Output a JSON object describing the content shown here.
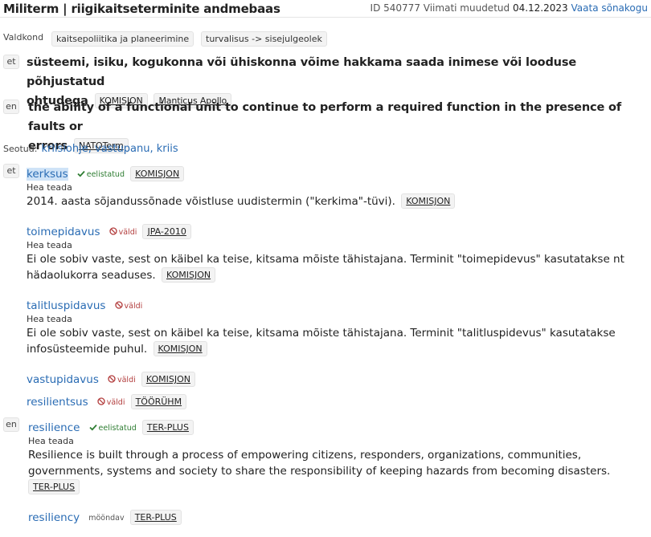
{
  "header": {
    "title": "Militerm | riigikaitseterminite andmebaas",
    "id_text": "ID 540777",
    "modified_text": "Viimati muudetud",
    "modified_date": "04.12.2023",
    "view_link": "Vaata sõnakogu"
  },
  "domain": {
    "label": "Valdkond",
    "tags": [
      "kaitsepoliitika ja planeerimine",
      "turvalisus -> sisejulgeolek"
    ]
  },
  "definitions": [
    {
      "lang": "et",
      "line1": "süsteemi, isiku, kogukonna või ühiskonna võime hakkama saada inimese või looduse põhjustatud",
      "line2": "ohtudega",
      "sources": [
        "KOMISJON",
        "Manticus Apollo"
      ]
    },
    {
      "lang": "en",
      "line1": "the ability of a functional unit to continue to perform a required function in the presence of faults or",
      "line2": "errors",
      "sources": [
        "NATOTerm"
      ]
    }
  ],
  "related": {
    "label": "Seotud:",
    "value": "kriisiohje, vastupanu, kriis"
  },
  "terms_et": [
    {
      "term": "kerksus",
      "status": "eelistatud",
      "source": "KOMISJON",
      "quality": "Hea teada",
      "note_line1": "2014. aasta sõjandussõnade võistluse uudistermin (\"kerkima\"-tüvi).",
      "note_source": "KOMISJON"
    },
    {
      "term": "toimepidavus",
      "status": "väldi",
      "source": "JPA-2010",
      "quality": "Hea teada",
      "note_line1": "Ei ole sobiv vaste, sest on käibel ka teise, kitsama mõiste tähistajana. Terminit \"toimepidevus\" kasutatakse nt",
      "note_line2": "hädaolukorra seaduses.",
      "note_source": "KOMISJON"
    },
    {
      "term": "talitluspidavus",
      "status": "väldi",
      "quality": "Hea teada",
      "note_line1": "Ei ole sobiv vaste, sest on käibel ka teise, kitsama mõiste tähistajana. Terminit \"talitluspidevus\" kasutatakse",
      "note_line2": "infosüsteemide puhul.",
      "note_source": "KOMISJON"
    },
    {
      "term": "vastupidavus",
      "status": "väldi",
      "source": "KOMISJON"
    },
    {
      "term": "resilientsus",
      "status": "väldi",
      "source": "TÖÖRÜHM"
    }
  ],
  "terms_en": [
    {
      "lang": "en",
      "term": "resilience",
      "status": "eelistatud",
      "source": "TER-PLUS",
      "quality": "Hea teada",
      "note_line1": "Resilience is built through a process of empowering citizens, responders, organizations, communities,",
      "note_line2": "governments, systems and society to share the responsibility of keeping hazards from becoming disasters.",
      "note_source": "TER-PLUS"
    },
    {
      "term": "resiliency",
      "status": "mööndav",
      "source": "TER-PLUS"
    }
  ],
  "colors": {
    "link": "#2a6cb4",
    "preferred": "#2e7d32",
    "avoid": "#b23c3c"
  }
}
